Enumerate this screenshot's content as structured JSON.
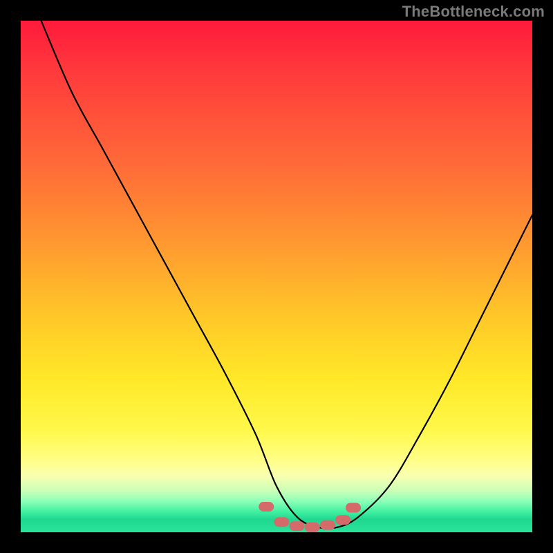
{
  "watermark": "TheBottleneck.com",
  "colors": {
    "frame": "#000000",
    "gradient_top": "#ff1a3c",
    "gradient_mid": "#ffe828",
    "gradient_bottom": "#29e49a",
    "curve": "#000000",
    "marker": "#d46a6a"
  },
  "chart_data": {
    "type": "line",
    "title": "",
    "xlabel": "",
    "ylabel": "",
    "xlim": [
      0,
      100
    ],
    "ylim": [
      0,
      100
    ],
    "series": [
      {
        "name": "bottleneck-curve",
        "x": [
          4,
          10,
          16,
          22,
          28,
          34,
          40,
          46,
          50,
          54,
          58,
          62,
          66,
          72,
          78,
          84,
          90,
          96,
          100
        ],
        "values": [
          100,
          86,
          75,
          64,
          53,
          42,
          31,
          19,
          9,
          3,
          1,
          1,
          3,
          9,
          19,
          30,
          42,
          54,
          62
        ]
      }
    ],
    "markers": {
      "name": "bottom-highlight",
      "color": "#d46a6a",
      "x": [
        48,
        51,
        54,
        57,
        60,
        63,
        65
      ],
      "values": [
        5.0,
        2.0,
        1.2,
        1.0,
        1.4,
        2.4,
        4.8
      ]
    }
  }
}
